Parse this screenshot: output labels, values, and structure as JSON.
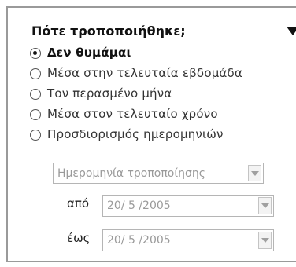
{
  "panel": {
    "title": "Πότε τροποποιήθηκε;",
    "collapse_icon": "triangle-down-icon"
  },
  "options": [
    {
      "label": "Δεν θυμάμαι",
      "selected": true
    },
    {
      "label": "Μέσα στην τελευταία εβδομάδα",
      "selected": false
    },
    {
      "label": "Τον περασμένο μήνα",
      "selected": false
    },
    {
      "label": "Μέσα στον τελευταίο χρόνο",
      "selected": false
    },
    {
      "label": "Προσδιορισμός ημερομηνιών",
      "selected": false
    }
  ],
  "date_type_select": {
    "value": "Ημερομηνία τροποποίησης"
  },
  "from": {
    "label": "από",
    "value": "20/ 5 /2005"
  },
  "to": {
    "label": "έως",
    "value": "20/ 5 /2005"
  }
}
